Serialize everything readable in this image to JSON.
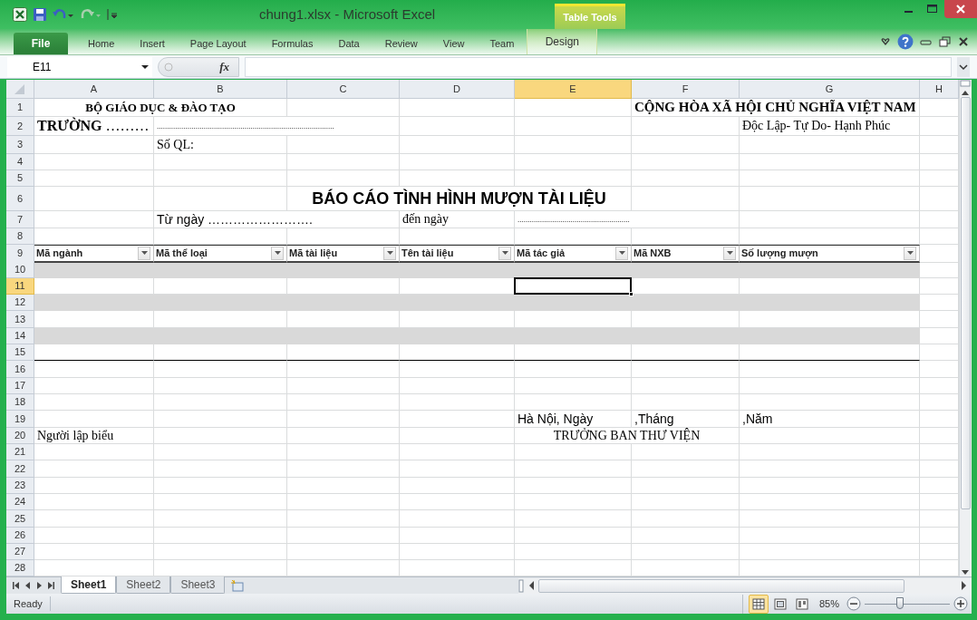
{
  "window": {
    "title": "chung1.xlsx - Microsoft Excel",
    "contextual_group": "Table Tools"
  },
  "ribbon_tabs": [
    {
      "label": "File",
      "kind": "file"
    },
    {
      "label": "Home",
      "kind": "tab"
    },
    {
      "label": "Insert",
      "kind": "tab"
    },
    {
      "label": "Page Layout",
      "kind": "tab"
    },
    {
      "label": "Formulas",
      "kind": "tab"
    },
    {
      "label": "Data",
      "kind": "tab"
    },
    {
      "label": "Review",
      "kind": "tab"
    },
    {
      "label": "View",
      "kind": "tab"
    },
    {
      "label": "Team",
      "kind": "tab"
    },
    {
      "label": "Design",
      "kind": "contextual"
    }
  ],
  "formula_bar": {
    "name_box": "E11",
    "function_label": "fx"
  },
  "columns": [
    {
      "label": "A",
      "selected": false
    },
    {
      "label": "B",
      "selected": false
    },
    {
      "label": "C",
      "selected": false
    },
    {
      "label": "D",
      "selected": false
    },
    {
      "label": "E",
      "selected": true
    },
    {
      "label": "F",
      "selected": false
    },
    {
      "label": "G",
      "selected": false
    },
    {
      "label": "H",
      "selected": false
    }
  ],
  "rows": [
    {
      "number": "1",
      "selected": false,
      "kind": "plain",
      "cells": [
        "BỘ GIÁO DỤC & ĐÀO TẠO",
        "CỘNG HÒA XÃ HỘI CHỦ NGHĨA VIỆT NAM"
      ]
    },
    {
      "number": "2",
      "selected": false,
      "kind": "plain",
      "cells": [
        "**TRƯỜNG** ………",
        ".......................................................................................",
        "Độc Lập- Tự Do- Hạnh Phúc"
      ]
    },
    {
      "number": "3",
      "selected": false,
      "kind": "plain",
      "cells": [
        "Số QL:"
      ]
    },
    {
      "number": "4",
      "selected": false,
      "kind": "plain",
      "cells": []
    },
    {
      "number": "5",
      "selected": false,
      "kind": "plain",
      "cells": []
    },
    {
      "number": "6",
      "selected": false,
      "kind": "plain",
      "cells": [
        "BÁO CÁO TÌNH HÌNH MƯỢN TÀI LIỆU"
      ]
    },
    {
      "number": "7",
      "selected": false,
      "kind": "plain",
      "cells": [
        "Từ ngày …………………….",
        "đến ngày",
        "......................................................."
      ]
    },
    {
      "number": "8",
      "selected": false,
      "kind": "plain",
      "cells": []
    },
    {
      "number": "9",
      "selected": false,
      "kind": "header",
      "cells": [
        "Mã ngành",
        "Mã thể loại",
        "Mã tài liệu",
        "Tên tài liệu",
        "Mã tác giả",
        "Mã NXB",
        "Số lượng mượn"
      ]
    },
    {
      "number": "10",
      "selected": false,
      "kind": "band",
      "cells": []
    },
    {
      "number": "11",
      "selected": true,
      "kind": "row",
      "cells": []
    },
    {
      "number": "12",
      "selected": false,
      "kind": "band",
      "cells": []
    },
    {
      "number": "13",
      "selected": false,
      "kind": "row",
      "cells": []
    },
    {
      "number": "14",
      "selected": false,
      "kind": "band",
      "cells": []
    },
    {
      "number": "15",
      "selected": false,
      "kind": "last",
      "cells": []
    },
    {
      "number": "16",
      "selected": false,
      "kind": "plain",
      "cells": []
    },
    {
      "number": "17",
      "selected": false,
      "kind": "plain",
      "cells": []
    },
    {
      "number": "18",
      "selected": false,
      "kind": "plain",
      "cells": []
    },
    {
      "number": "19",
      "selected": false,
      "kind": "plain",
      "cells": [
        "Hà Nội, Ngày",
        ",Tháng",
        ",Năm"
      ]
    },
    {
      "number": "20",
      "selected": false,
      "kind": "plain",
      "cells": [
        "Người lập biểu",
        "TRƯỞNG BAN THƯ VIỆN"
      ]
    },
    {
      "number": "21",
      "selected": false,
      "kind": "plain",
      "cells": []
    },
    {
      "number": "22",
      "selected": false,
      "kind": "plain",
      "cells": []
    },
    {
      "number": "23",
      "selected": false,
      "kind": "plain",
      "cells": []
    },
    {
      "number": "24",
      "selected": false,
      "kind": "plain",
      "cells": []
    },
    {
      "number": "25",
      "selected": false,
      "kind": "plain",
      "cells": []
    },
    {
      "number": "26",
      "selected": false,
      "kind": "plain",
      "cells": []
    },
    {
      "number": "27",
      "selected": false,
      "kind": "plain",
      "cells": []
    },
    {
      "number": "28",
      "selected": false,
      "kind": "plain",
      "cells": []
    }
  ],
  "sheet_tabs": [
    {
      "label": "Sheet1",
      "selected": true
    },
    {
      "label": "Sheet2",
      "selected": false
    },
    {
      "label": "Sheet3",
      "selected": false
    }
  ],
  "status_bar": {
    "text": "Ready",
    "views": [
      {
        "kind": "normal",
        "selected": true
      },
      {
        "kind": "page-layout",
        "selected": false
      },
      {
        "kind": "page-break",
        "selected": false
      }
    ],
    "zoom": "85%",
    "zoom_slider": {
      "level": 0.42
    }
  }
}
